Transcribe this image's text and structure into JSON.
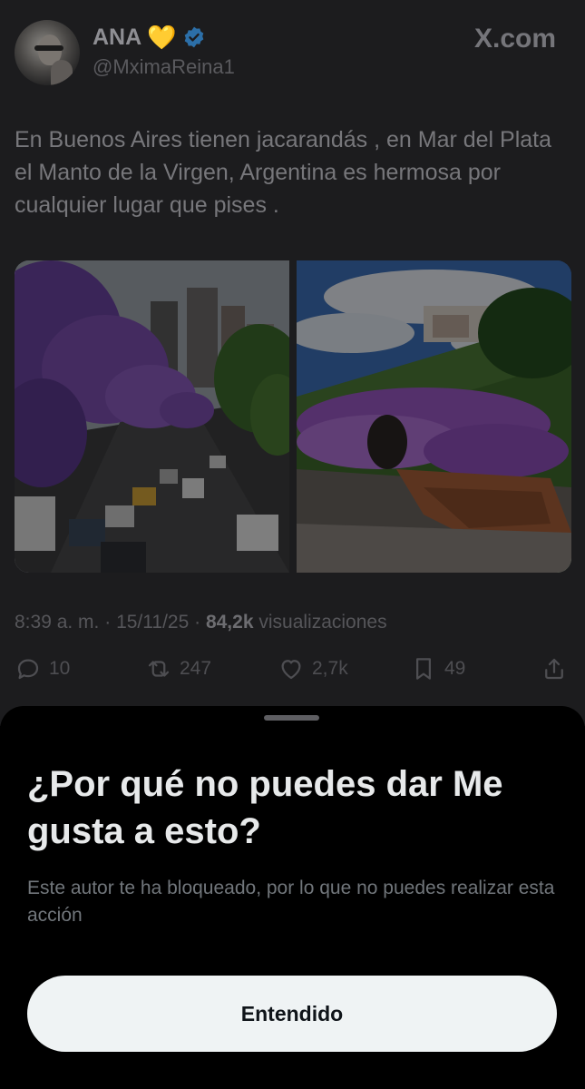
{
  "author": {
    "name": "ANA",
    "emoji": "💛",
    "handle": "@MximaReina1"
  },
  "brand": "X.com",
  "tweet": {
    "text": "En Buenos Aires tienen jacarandás , en Mar del Plata el Manto de la Virgen, Argentina es hermosa por cualquier lugar que pises .",
    "time": "8:39 a. m.",
    "date": "15/11/25",
    "separator": "·",
    "views_count": "84,2k",
    "views_label": "visualizaciones"
  },
  "actions": {
    "replies": "10",
    "reposts": "247",
    "likes": "2,7k",
    "bookmarks": "49"
  },
  "sheet": {
    "title": "¿Por qué no puedes dar Me gusta a esto?",
    "description": "Este autor te ha bloqueado, por lo que no puedes realizar esta acción",
    "button_label": "Entendido"
  },
  "colors": {
    "verified": "#1d9bf0",
    "jacaranda": "#7d4fb0",
    "button_bg": "#eff3f4"
  }
}
